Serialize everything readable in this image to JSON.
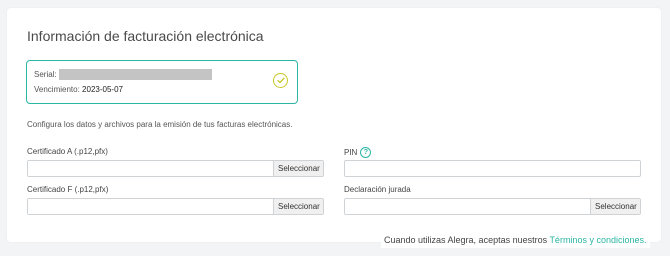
{
  "section": {
    "title": "Información de facturación electrónica"
  },
  "certificate_status": {
    "serial_label": "Serial:",
    "expiration_label": "Vencimiento:",
    "expiration_date": "2023-05-07",
    "status_icon": "check-circle-icon",
    "border_color": "#2bb5a3",
    "icon_color": "#c8c72a"
  },
  "description": "Configura los datos y archivos para la emisión de tus facturas electrónicas.",
  "fields": {
    "cert_a": {
      "label": "Certificado A (.p12,pfx)",
      "button": "Seleccionar"
    },
    "pin": {
      "label": "PIN",
      "help_icon": "question-circle-icon"
    },
    "cert_f": {
      "label": "Certificado F (.p12,pfx)",
      "button": "Seleccionar"
    },
    "declaracion": {
      "label": "Declaración jurada",
      "button": "Seleccionar"
    }
  },
  "footer": {
    "text": "Cuando utilizas Alegra, aceptas nuestros ",
    "link": "Términos y condiciones",
    "suffix": ".",
    "link_color": "#2bb5a3"
  }
}
